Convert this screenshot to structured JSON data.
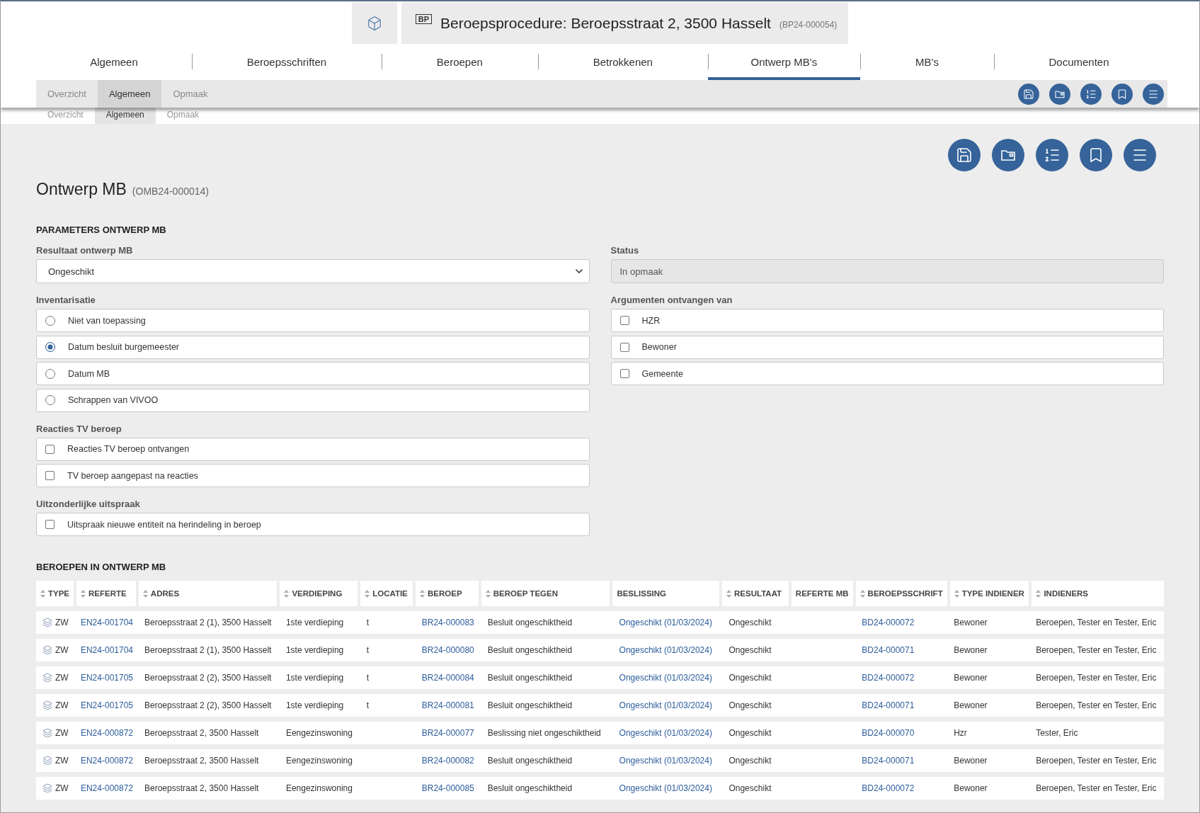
{
  "header": {
    "badge": "BP",
    "title": "Beroepsprocedure: Beroepsstraat 2, 3500 Hasselt",
    "code": "(BP24-000054)"
  },
  "tabs": [
    {
      "label": "Algemeen",
      "selected": false
    },
    {
      "label": "Beroepsschriften",
      "selected": false
    },
    {
      "label": "Beroepen",
      "selected": false
    },
    {
      "label": "Betrokkenen",
      "selected": false
    },
    {
      "label": "Ontwerp MB's",
      "selected": true
    },
    {
      "label": "MB's",
      "selected": false
    },
    {
      "label": "Documenten",
      "selected": false
    }
  ],
  "subnav": [
    {
      "label": "Overzicht",
      "selected": false
    },
    {
      "label": "Algemeen",
      "selected": true
    },
    {
      "label": "Opmaak",
      "selected": false
    }
  ],
  "hidden_subnav": [
    {
      "label": "Overzicht",
      "selected": false
    },
    {
      "label": "Algemeen",
      "selected": true
    },
    {
      "label": "Opmaak",
      "selected": false
    }
  ],
  "page": {
    "title": "Ontwerp MB",
    "code": "(OMB24-000014)"
  },
  "parameters": {
    "title": "PARAMETERS ONTWERP MB",
    "resultaat": {
      "label": "Resultaat ontwerp MB",
      "value": "Ongeschikt"
    },
    "status": {
      "label": "Status",
      "value": "In opmaak",
      "disabled": true
    },
    "inventarisatie": {
      "label": "Inventarisatie",
      "options": [
        {
          "label": "Niet van toepassing",
          "selected": false
        },
        {
          "label": "Datum besluit burgemeester",
          "selected": true
        },
        {
          "label": "Datum MB",
          "selected": false
        },
        {
          "label": "Schrappen van VIVOO",
          "selected": false
        }
      ]
    },
    "argumenten": {
      "label": "Argumenten ontvangen van",
      "options": [
        {
          "label": "HZR",
          "checked": false
        },
        {
          "label": "Bewoner",
          "checked": false
        },
        {
          "label": "Gemeente",
          "checked": false
        }
      ]
    },
    "reacties": {
      "label": "Reacties TV beroep",
      "options": [
        {
          "label": "Reacties TV beroep ontvangen",
          "checked": false
        },
        {
          "label": "TV beroep aangepast na reacties",
          "checked": false
        }
      ]
    },
    "uitzonderlijk": {
      "label": "Uitzonderlijke uitspraak",
      "options": [
        {
          "label": "Uitspraak nieuwe entiteit na herindeling in beroep",
          "checked": false
        }
      ]
    }
  },
  "table": {
    "title": "BEROEPEN IN ONTWERP MB",
    "columns": [
      {
        "label": "TYPE",
        "sortable": true
      },
      {
        "label": "REFERTE",
        "sortable": true
      },
      {
        "label": "ADRES",
        "sortable": true
      },
      {
        "label": "VERDIEPING",
        "sortable": true
      },
      {
        "label": "LOCATIE",
        "sortable": true
      },
      {
        "label": "BEROEP",
        "sortable": true
      },
      {
        "label": "BEROEP TEGEN",
        "sortable": true
      },
      {
        "label": "BESLISSING",
        "sortable": false
      },
      {
        "label": "RESULTAAT",
        "sortable": true
      },
      {
        "label": "REFERTE MB",
        "sortable": false
      },
      {
        "label": "BEROEPSSCHRIFT",
        "sortable": true
      },
      {
        "label": "TYPE INDIENER",
        "sortable": true
      },
      {
        "label": "INDIENERS",
        "sortable": true
      }
    ],
    "rows": [
      {
        "type": "ZW",
        "referte": "EN24-001704",
        "adres": "Beroepsstraat 2 (1), 3500 Hasselt",
        "verdieping": "1ste verdieping",
        "locatie": "t",
        "beroep": "BR24-000083",
        "beroep_tegen": "Besluit ongeschiktheid",
        "beslissing": "Ongeschikt (01/03/2024)",
        "resultaat": "Ongeschikt",
        "beroepsschrift": "BD24-000072",
        "type_indiener": "Bewoner",
        "indieners": "Beroepen, Tester en Tester, Eric"
      },
      {
        "type": "ZW",
        "referte": "EN24-001704",
        "adres": "Beroepsstraat 2 (1), 3500 Hasselt",
        "verdieping": "1ste verdieping",
        "locatie": "t",
        "beroep": "BR24-000080",
        "beroep_tegen": "Besluit ongeschiktheid",
        "beslissing": "Ongeschikt (01/03/2024)",
        "resultaat": "Ongeschikt",
        "beroepsschrift": "BD24-000071",
        "type_indiener": "Bewoner",
        "indieners": "Beroepen, Tester en Tester, Eric"
      },
      {
        "type": "ZW",
        "referte": "EN24-001705",
        "adres": "Beroepsstraat 2 (2), 3500 Hasselt",
        "verdieping": "1ste verdieping",
        "locatie": "t",
        "beroep": "BR24-000084",
        "beroep_tegen": "Besluit ongeschiktheid",
        "beslissing": "Ongeschikt (01/03/2024)",
        "resultaat": "Ongeschikt",
        "beroepsschrift": "BD24-000072",
        "type_indiener": "Bewoner",
        "indieners": "Beroepen, Tester en Tester, Eric"
      },
      {
        "type": "ZW",
        "referte": "EN24-001705",
        "adres": "Beroepsstraat 2 (2), 3500 Hasselt",
        "verdieping": "1ste verdieping",
        "locatie": "t",
        "beroep": "BR24-000081",
        "beroep_tegen": "Besluit ongeschiktheid",
        "beslissing": "Ongeschikt (01/03/2024)",
        "resultaat": "Ongeschikt",
        "beroepsschrift": "BD24-000071",
        "type_indiener": "Bewoner",
        "indieners": "Beroepen, Tester en Tester, Eric"
      },
      {
        "type": "ZW",
        "referte": "EN24-000872",
        "adres": "Beroepsstraat 2, 3500 Hasselt",
        "verdieping": "Eengezinswoning",
        "beroep": "BR24-000077",
        "beroep_tegen": "Beslissing niet ongeschiktheid",
        "beslissing": "Ongeschikt (01/03/2024)",
        "resultaat": "Ongeschikt",
        "beroepsschrift": "BD24-000070",
        "type_indiener": "Hzr",
        "indieners": "Tester, Eric"
      },
      {
        "type": "ZW",
        "referte": "EN24-000872",
        "adres": "Beroepsstraat 2, 3500 Hasselt",
        "verdieping": "Eengezinswoning",
        "beroep": "BR24-000082",
        "beroep_tegen": "Besluit ongeschiktheid",
        "beslissing": "Ongeschikt (01/03/2024)",
        "resultaat": "Ongeschikt",
        "beroepsschrift": "BD24-000071",
        "type_indiener": "Bewoner",
        "indieners": "Beroepen, Tester en Tester, Eric"
      },
      {
        "type": "ZW",
        "referte": "EN24-000872",
        "adres": "Beroepsstraat 2, 3500 Hasselt",
        "verdieping": "Eengezinswoning",
        "beroep": "BR24-000085",
        "beroep_tegen": "Besluit ongeschiktheid",
        "beslissing": "Ongeschikt (01/03/2024)",
        "resultaat": "Ongeschikt",
        "beroepsschrift": "BD24-000072",
        "type_indiener": "Bewoner",
        "indieners": "Beroepen, Tester en Tester, Eric"
      }
    ]
  }
}
